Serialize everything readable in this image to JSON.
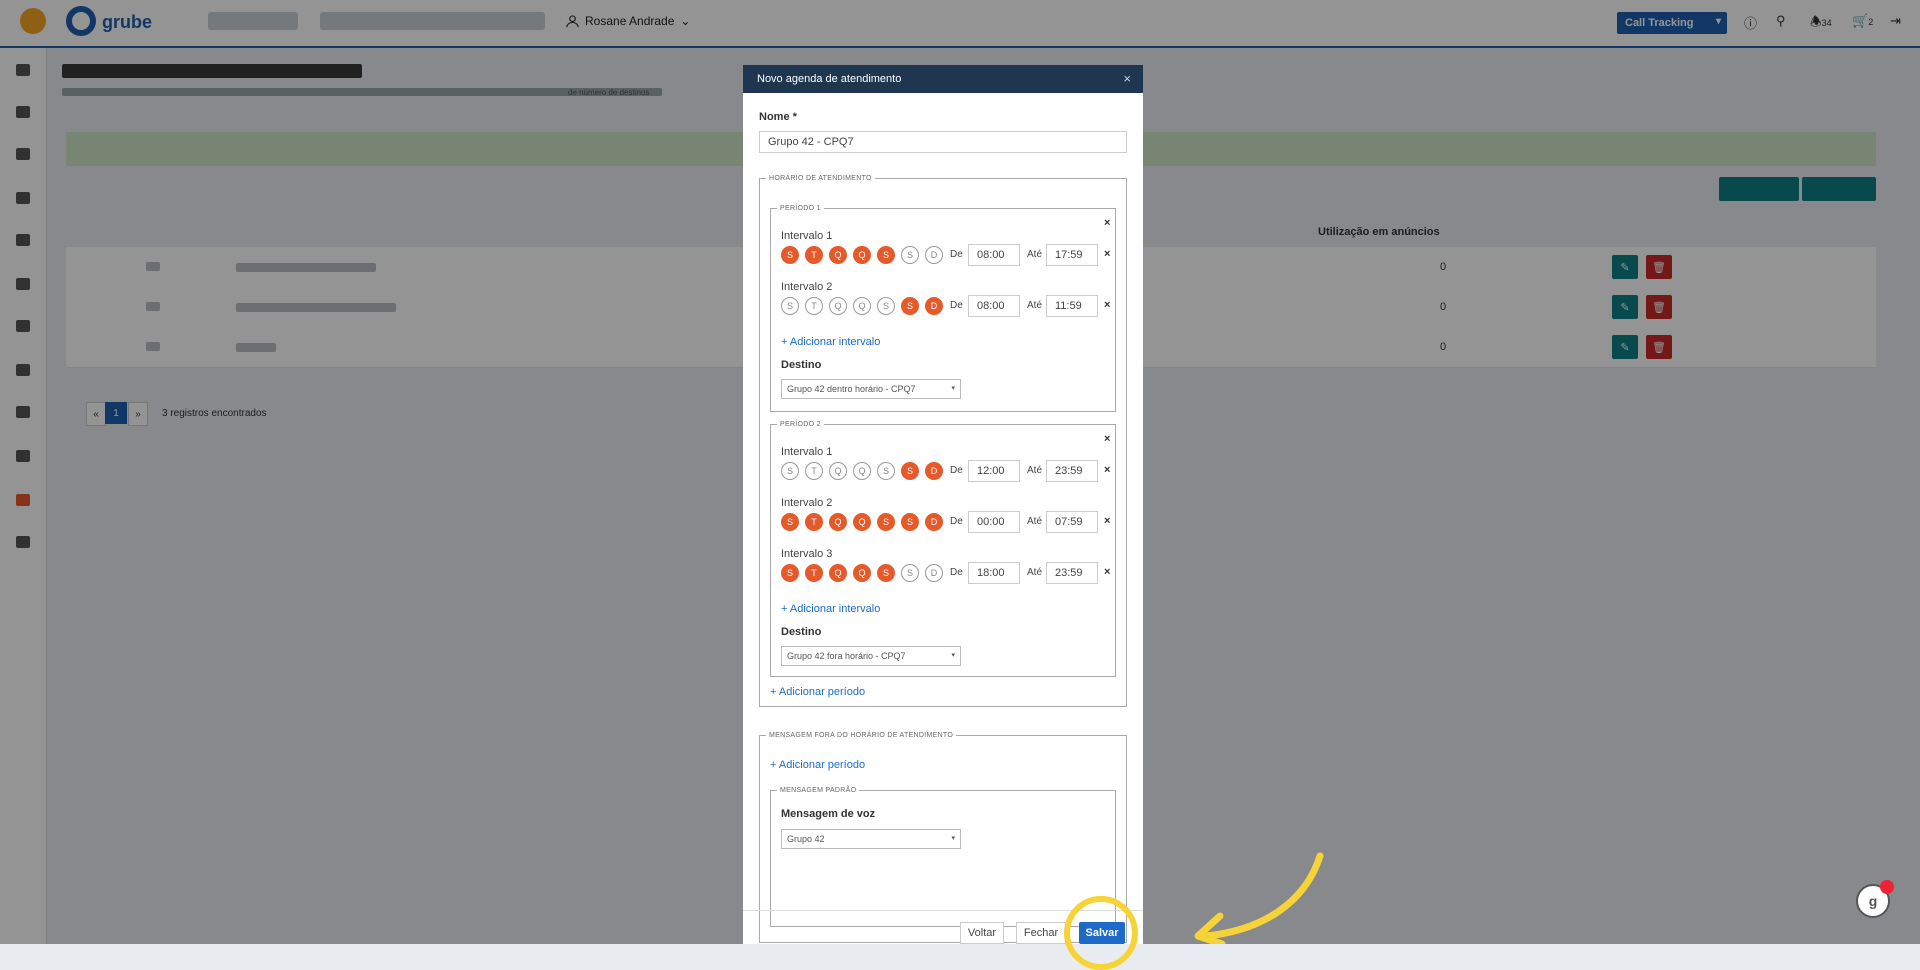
{
  "topbar": {
    "user_name": "Rosane Andrade",
    "call_tracking": "Call Tracking",
    "notifications_count": "34",
    "cart_count": "2"
  },
  "table": {
    "header_usage": "Utilização em anúncios",
    "rows": [
      {
        "usage": "0"
      },
      {
        "usage": "0"
      },
      {
        "usage": "0"
      }
    ]
  },
  "background": {
    "breadcrumb_tail": "de número de destinos"
  },
  "pagination": {
    "prev": "«",
    "current": "1",
    "next": "»",
    "records": "3 registros encontrados"
  },
  "modal": {
    "title": "Novo agenda de atendimento",
    "name_label": "Nome *",
    "name_value": "Grupo 42 - CPQ7",
    "schedule_legend": "Horário de atendimento",
    "periods": [
      {
        "legend": "Período 1",
        "intervals": [
          {
            "label": "Intervalo 1",
            "days": [
              "S",
              "T",
              "Q",
              "Q",
              "S",
              "S",
              "D"
            ],
            "active": [
              true,
              true,
              true,
              true,
              true,
              false,
              false
            ],
            "from_label": "De",
            "from": "08:00",
            "to_label": "Até",
            "to": "17:59"
          },
          {
            "label": "Intervalo 2",
            "days": [
              "S",
              "T",
              "Q",
              "Q",
              "S",
              "S",
              "D"
            ],
            "active": [
              false,
              false,
              false,
              false,
              false,
              true,
              true
            ],
            "from_label": "De",
            "from": "08:00",
            "to_label": "Até",
            "to": "11:59"
          }
        ],
        "add_interval": "+ Adicionar intervalo",
        "destination_label": "Destino",
        "destination": "Grupo 42 dentro horário - CPQ7"
      },
      {
        "legend": "Período 2",
        "intervals": [
          {
            "label": "Intervalo 1",
            "days": [
              "S",
              "T",
              "Q",
              "Q",
              "S",
              "S",
              "D"
            ],
            "active": [
              false,
              false,
              false,
              false,
              false,
              true,
              true
            ],
            "from_label": "De",
            "from": "12:00",
            "to_label": "Até",
            "to": "23:59"
          },
          {
            "label": "Intervalo 2",
            "days": [
              "S",
              "T",
              "Q",
              "Q",
              "S",
              "S",
              "D"
            ],
            "active": [
              true,
              true,
              true,
              true,
              true,
              true,
              true
            ],
            "from_label": "De",
            "from": "00:00",
            "to_label": "Até",
            "to": "07:59"
          },
          {
            "label": "Intervalo 3",
            "days": [
              "S",
              "T",
              "Q",
              "Q",
              "S",
              "S",
              "D"
            ],
            "active": [
              true,
              true,
              true,
              true,
              true,
              false,
              false
            ],
            "from_label": "De",
            "from": "18:00",
            "to_label": "Até",
            "to": "23:59"
          }
        ],
        "add_interval": "+ Adicionar intervalo",
        "destination_label": "Destino",
        "destination": "Grupo 42 fora horário - CPQ7"
      }
    ],
    "add_period": "+ Adicionar período",
    "outside_legend": "Mensagem fora do horário de atendimento",
    "outside_add_period": "+ Adicionar período",
    "default_legend": "Mensagem padrão",
    "voice_label": "Mensagem de voz",
    "voice_value": "Grupo 42",
    "back": "Voltar",
    "close": "Fechar",
    "save": "Salvar"
  },
  "colors": {
    "accent": "#1d5fb0",
    "day_active": "#e55a2b",
    "teal": "#0d7f86",
    "danger": "#c62828",
    "highlight": "#f7d33a"
  }
}
